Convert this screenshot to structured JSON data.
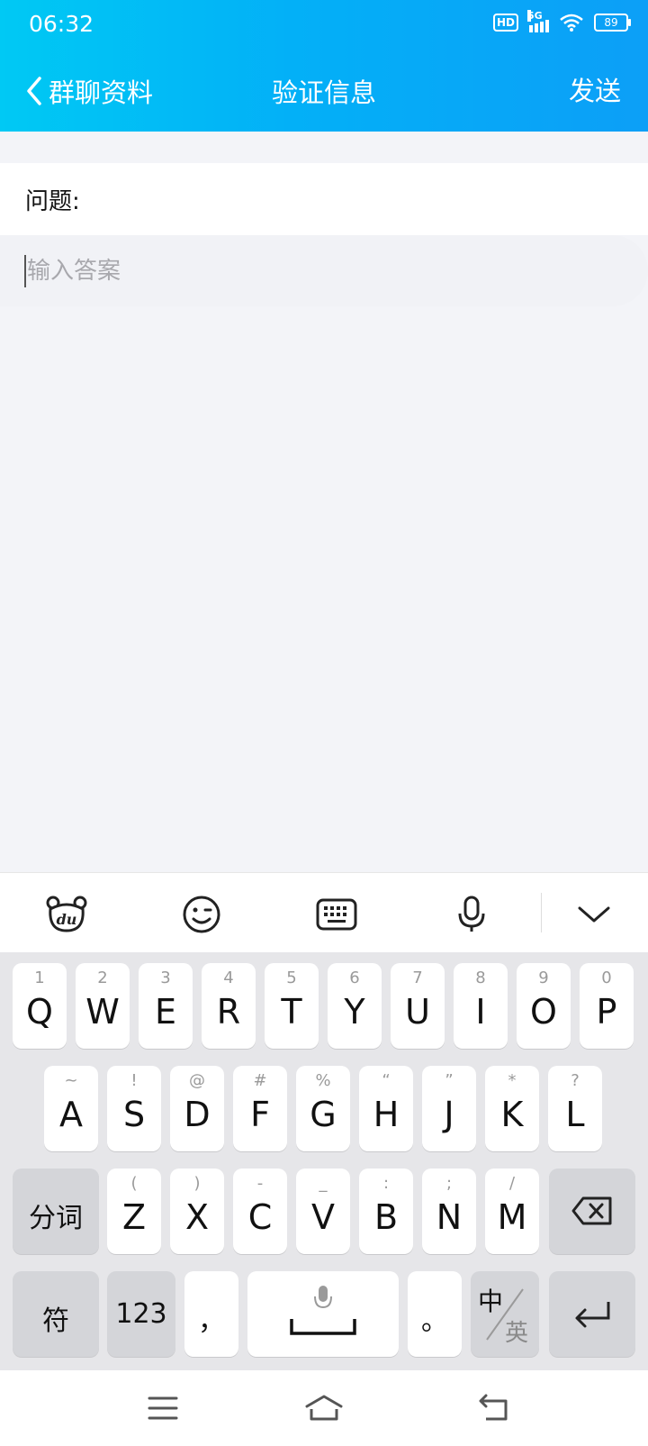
{
  "status_bar": {
    "time": "06:32",
    "hd": "HD",
    "network": "5G",
    "battery": "89"
  },
  "header": {
    "back_label": "群聊资料",
    "title": "验证信息",
    "send_label": "发送"
  },
  "form": {
    "question_label": "问题:",
    "answer_placeholder": "输入答案"
  },
  "keyboard": {
    "toolbar_icons": [
      "du-logo-icon",
      "emoji-icon",
      "keyboard-icon",
      "microphone-icon",
      "chevron-down-icon"
    ],
    "row1": [
      [
        "1",
        "Q"
      ],
      [
        "2",
        "W"
      ],
      [
        "3",
        "E"
      ],
      [
        "4",
        "R"
      ],
      [
        "5",
        "T"
      ],
      [
        "6",
        "Y"
      ],
      [
        "7",
        "U"
      ],
      [
        "8",
        "I"
      ],
      [
        "9",
        "O"
      ],
      [
        "0",
        "P"
      ]
    ],
    "row2": [
      [
        "~",
        "A"
      ],
      [
        "!",
        "S"
      ],
      [
        "@",
        "D"
      ],
      [
        "#",
        "F"
      ],
      [
        "%",
        "G"
      ],
      [
        "“",
        "H"
      ],
      [
        "”",
        "J"
      ],
      [
        "*",
        "K"
      ],
      [
        "?",
        "L"
      ]
    ],
    "row3": [
      [
        "(",
        "Z"
      ],
      [
        ")",
        "X"
      ],
      [
        "-",
        "C"
      ],
      [
        "_",
        "V"
      ],
      [
        ":",
        "B"
      ],
      [
        ";",
        "N"
      ],
      [
        "/",
        "M"
      ]
    ],
    "fenci_label": "分词",
    "fu_label": "符",
    "num_label": "123",
    "comma_label": "，",
    "period_label": "。",
    "lang_primary": "中",
    "lang_secondary": "英"
  },
  "nav": {
    "icons": [
      "menu-icon",
      "home-icon",
      "back-icon"
    ]
  }
}
